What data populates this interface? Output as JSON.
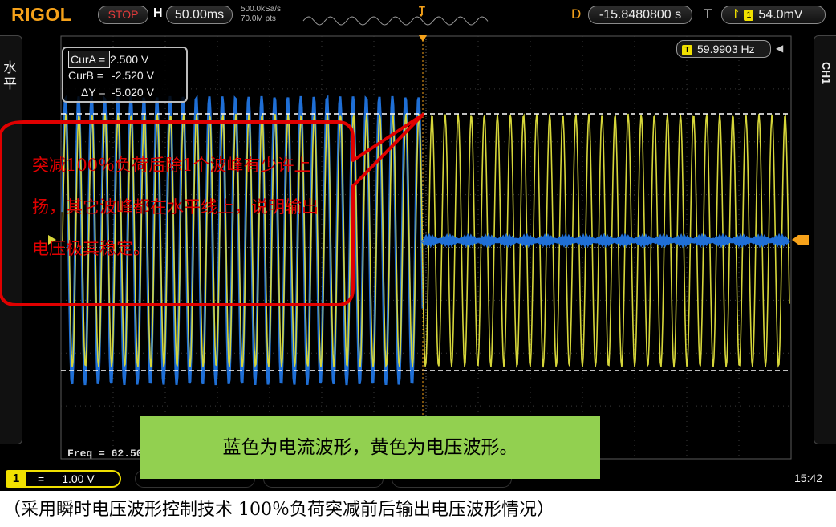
{
  "topbar": {
    "brand": "RIGOL",
    "run_state": "STOP",
    "horizontal_label": "H",
    "timebase": "50.00ms",
    "sample_rate": "500.0kSa/s",
    "memory_depth": "70.0M pts",
    "delay_label": "D",
    "delay_value": "-15.8480800 s",
    "trigger_label": "T",
    "trigger_source": "1",
    "trigger_level": "54.0mV"
  },
  "left_tab": {
    "label": "水平"
  },
  "right_tab": {
    "label": "CH1"
  },
  "cursors": {
    "a_label": "CurA =",
    "a_value": "2.500 V",
    "b_label": "CurB =",
    "b_value": "-2.520 V",
    "dy_label": "ΔY =",
    "dy_value": "-5.020 V"
  },
  "frequency": {
    "icon": "T",
    "value": "59.9903 Hz"
  },
  "freq_measure": "Freq = 62.50",
  "bottombar": {
    "channel": "1",
    "coupling_symbol": "=",
    "channel_scale": "1.00 V",
    "time": "15:42"
  },
  "annotations": {
    "callout_text": "突减100％负荷后除1个波峰有少许上扬，其它波峰都在水平线上，说明输出电压极其稳定。",
    "green_note": "蓝色为电流波形，黄色为电压波形。",
    "caption": "（采用瞬时电压波形控制技术 100％负荷突减前后输出电压波形情况）"
  },
  "colors": {
    "voltage_trace": "#d6d63a",
    "current_trace": "#1f6fd6",
    "brand": "#f6a21a",
    "callout_border": "#e00000",
    "note_bg": "#92d050"
  }
}
